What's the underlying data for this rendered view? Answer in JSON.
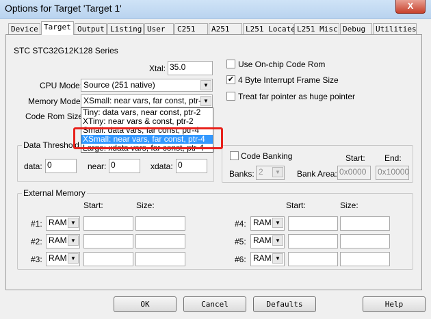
{
  "window": {
    "title": "Options for Target 'Target 1'",
    "close": "X"
  },
  "tabs": [
    "Device",
    "Target",
    "Output",
    "Listing",
    "User",
    "C251",
    "A251",
    "L251 Locate",
    "L251 Misc",
    "Debug",
    "Utilities"
  ],
  "series": "STC STC32G12K128 Series",
  "xtal": {
    "label": "Xtal:",
    "value": "35.0"
  },
  "cpu_mode": {
    "label": "CPU Mode:",
    "value": "Source (251 native)"
  },
  "memory_model": {
    "label": "Memory Model:",
    "value": "XSmall: near vars, far const, ptr-4",
    "options": [
      "Tiny: data vars, near const, ptr-2",
      "XTiny: near vars & const, ptr-2",
      "Small: data vars, far const, ptr-4",
      "XSmall: near vars, far const, ptr-4",
      "Large: xdata vars, far const, ptr-4"
    ]
  },
  "code_rom_size": {
    "label": "Code Rom Size:"
  },
  "checkboxes": [
    {
      "label": "Use On-chip Code Rom",
      "checked": false
    },
    {
      "label": "4 Byte Interrupt Frame Size",
      "checked": true
    },
    {
      "label": "Treat far pointer as huge pointer",
      "checked": false
    }
  ],
  "data_threshold": {
    "title": "Data Threshold",
    "data_label": "data:",
    "data": "0",
    "near_label": "near:",
    "near": "0",
    "xdata_label": "xdata:",
    "xdata": "0"
  },
  "banking": {
    "label": "Code Banking",
    "checked": false,
    "banks_label": "Banks:",
    "banks": "2",
    "bank_area_label": "Bank Area:",
    "start_label": "Start:",
    "end_label": "End:",
    "start": "0x0000",
    "end": "0x10000"
  },
  "external_memory": {
    "title": "External Memory",
    "start_label": "Start:",
    "size_label": "Size:",
    "rows": [
      {
        "label": "#1:",
        "type": "RAM"
      },
      {
        "label": "#2:",
        "type": "RAM"
      },
      {
        "label": "#3:",
        "type": "RAM"
      },
      {
        "label": "#4:",
        "type": "RAM"
      },
      {
        "label": "#5:",
        "type": "RAM"
      },
      {
        "label": "#6:",
        "type": "RAM"
      }
    ]
  },
  "buttons": {
    "ok": "OK",
    "cancel": "Cancel",
    "defaults": "Defaults",
    "help": "Help"
  },
  "arrow": "▼",
  "check": "✔"
}
